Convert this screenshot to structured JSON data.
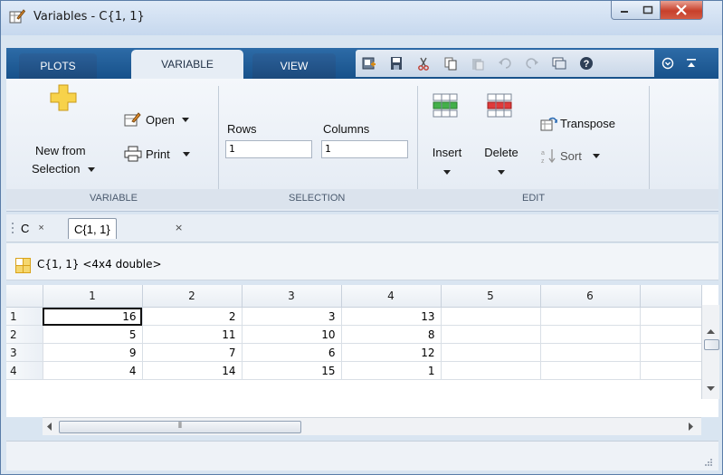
{
  "window": {
    "title": "Variables - C{1, 1}",
    "controls": {
      "minimize": "minimize",
      "maximize": "maximize",
      "close": "close"
    }
  },
  "toolstrip": {
    "tabs": [
      {
        "label": "PLOTS",
        "active": false
      },
      {
        "label": "VARIABLE",
        "active": true
      },
      {
        "label": "VIEW",
        "active": false
      }
    ],
    "quick_access_icons": [
      "new-variable-icon",
      "save-icon",
      "cut-icon",
      "copy-icon",
      "paste-icon",
      "undo-icon",
      "redo-icon",
      "switch-windows-icon",
      "help-icon"
    ]
  },
  "ribbon": {
    "variable_section": {
      "label": "VARIABLE",
      "new_from_selection": "New from",
      "new_from_selection_2": "Selection",
      "open": "Open",
      "print": "Print"
    },
    "selection_section": {
      "label": "SELECTION",
      "rows_label": "Rows",
      "rows_value": "1",
      "columns_label": "Columns",
      "columns_value": "1"
    },
    "edit_section": {
      "label": "EDIT",
      "insert": "Insert",
      "delete": "Delete",
      "transpose": "Transpose",
      "sort": "Sort"
    }
  },
  "doc_tabs": [
    {
      "label": "C",
      "active": false
    },
    {
      "label": "C{1, 1}",
      "active": true
    }
  ],
  "variable_header": "C{1, 1} <4x4 double>",
  "grid": {
    "columns": [
      "1",
      "2",
      "3",
      "4",
      "5",
      "6"
    ],
    "rows": [
      {
        "index": "1",
        "cells": [
          "16",
          "2",
          "3",
          "13",
          "",
          ""
        ]
      },
      {
        "index": "2",
        "cells": [
          "5",
          "11",
          "10",
          "8",
          "",
          ""
        ]
      },
      {
        "index": "3",
        "cells": [
          "9",
          "7",
          "6",
          "12",
          "",
          ""
        ]
      },
      {
        "index": "4",
        "cells": [
          "4",
          "14",
          "15",
          "1",
          "",
          ""
        ]
      }
    ],
    "selected_cell": {
      "row": 1,
      "col": 1
    }
  },
  "colors": {
    "tab_strip": "#1c5491",
    "ribbon_bg": "#eef2f7",
    "close_button": "#c7402b"
  }
}
